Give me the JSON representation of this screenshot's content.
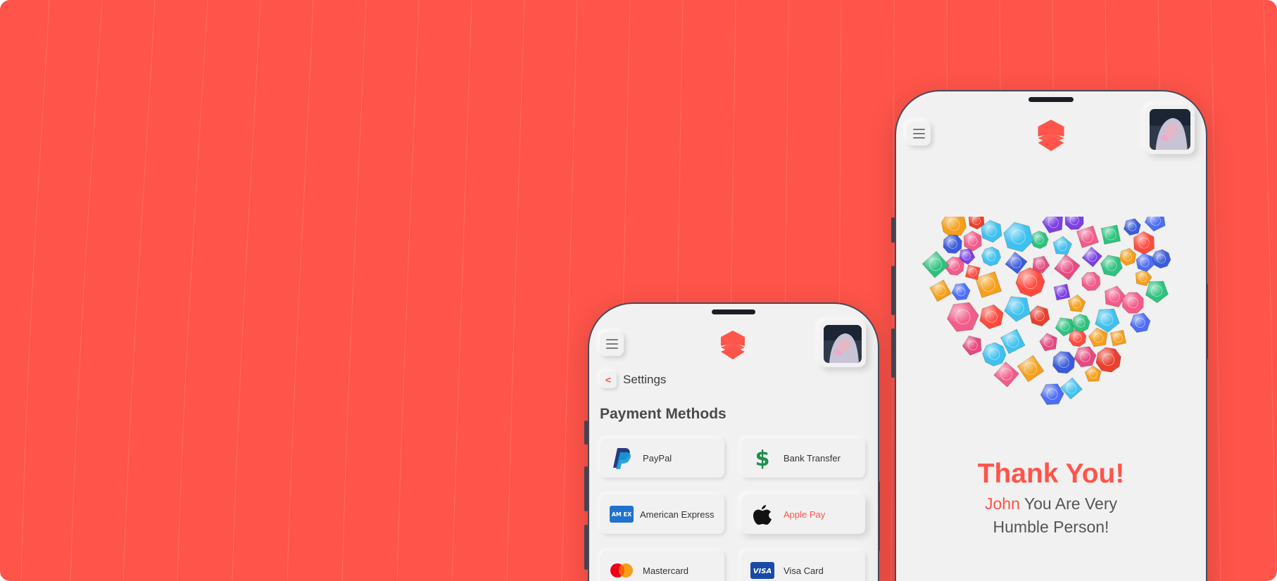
{
  "colors": {
    "background": "#ff544a",
    "accent": "#ff544a",
    "phone_screen": "#f1f1f1",
    "text_dark": "#4a4a4a"
  },
  "left_phone": {
    "menu_icon": "hamburger-icon",
    "back_icon": "chevron-left-icon",
    "back_symbol": "<",
    "settings_label": "Settings",
    "section_title": "Payment Methods",
    "payment_methods": [
      {
        "label": "PayPal",
        "icon": "paypal-icon"
      },
      {
        "label": "Bank Transfer",
        "icon": "dollar-icon"
      },
      {
        "label": "American Express",
        "icon": "amex-icon",
        "icon_text": "AM EX"
      },
      {
        "label": "Apple Pay",
        "icon": "apple-icon",
        "selected": true
      },
      {
        "label": "Mastercard",
        "icon": "mastercard-icon"
      },
      {
        "label": "Visa Card",
        "icon": "visa-icon",
        "icon_text": "VISA"
      }
    ]
  },
  "right_phone": {
    "menu_icon": "hamburger-icon",
    "illustration": "gem-heart",
    "thank_title": "Thank You!",
    "name": "John",
    "subtitle_rest": " You Are Very",
    "subtitle_line2": "Humble Person!"
  }
}
